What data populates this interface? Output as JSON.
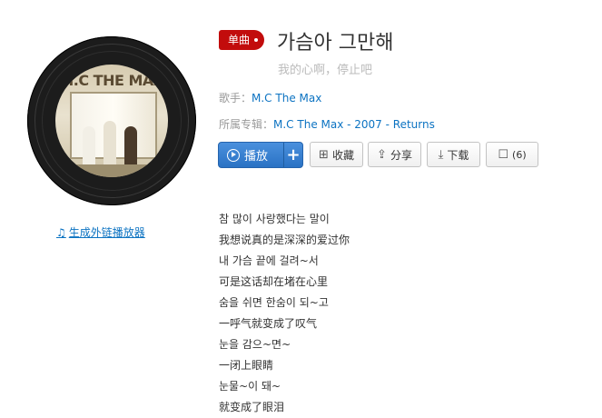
{
  "album_cover": {
    "logo_text": "M.C THE MAX",
    "icon": "vinyl-disc-icon"
  },
  "outer_player_link": {
    "label": "生成外链播放器",
    "icon": "music-note-icon"
  },
  "song": {
    "badge": "单曲",
    "title": "가슴아 그만해",
    "subtitle": "我的心啊，停止吧"
  },
  "meta": {
    "artist_label": "歌手：",
    "artist_name": "M.C The Max",
    "album_label": "所属专辑：",
    "album_name": "M.C The Max - 2007 - Returns"
  },
  "actions": {
    "play_label": "播放",
    "add_label": "+",
    "collect_label": "收藏",
    "share_label": "分享",
    "download_label": "下载",
    "comment_count": "(6)"
  },
  "lyrics": [
    "참 많이 사랑했다는 말이",
    "我想说真的是深深的爱过你",
    "내 가슴 끝에 걸려~서",
    "可是这话却在堵在心里",
    "숨을 쉬면 한숨이 되~고",
    "一呼气就变成了叹气",
    "눈을 감으~면~",
    "一闭上眼睛",
    "눈물~이 돼~",
    "就变成了眼泪"
  ],
  "colors": {
    "accent_red": "#c20c0c",
    "link_blue": "#0c73c2",
    "play_blue": "#2a72c4"
  }
}
